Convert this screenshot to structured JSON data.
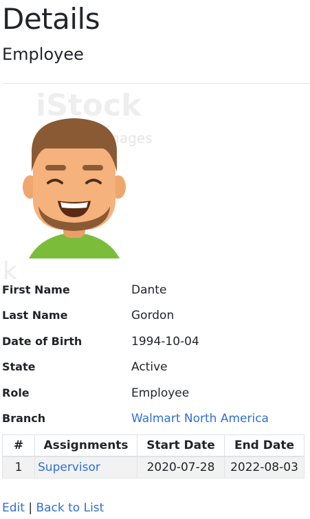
{
  "page": {
    "title": "Details",
    "subtitle": "Employee"
  },
  "avatar": {
    "watermark_line1": "iStock",
    "watermark_line2": "by Getty Images",
    "colors": {
      "hair": "#8a5a34",
      "skin": "#f5b27c",
      "beard": "#8a5a34",
      "shirt": "#7bbd3a"
    }
  },
  "details": [
    {
      "label": "First Name",
      "value": "Dante",
      "is_link": false
    },
    {
      "label": "Last Name",
      "value": "Gordon",
      "is_link": false
    },
    {
      "label": "Date of Birth",
      "value": "1994-10-04",
      "is_link": false
    },
    {
      "label": "State",
      "value": "Active",
      "is_link": false
    },
    {
      "label": "Role",
      "value": "Employee",
      "is_link": false
    },
    {
      "label": "Branch",
      "value": "Walmart North America",
      "is_link": true
    }
  ],
  "assignments_table": {
    "headers": [
      "#",
      "Assignments",
      "Start Date",
      "End Date"
    ],
    "rows": [
      {
        "num": "1",
        "assignment": "Supervisor",
        "start": "2020-07-28",
        "end": "2022-08-03"
      }
    ]
  },
  "footer": {
    "edit_label": "Edit",
    "separator": "|",
    "back_label": "Back to List"
  },
  "colors": {
    "link": "#2e6fd6",
    "row_bg": "#f2f2f2",
    "border": "#dee2e6"
  }
}
